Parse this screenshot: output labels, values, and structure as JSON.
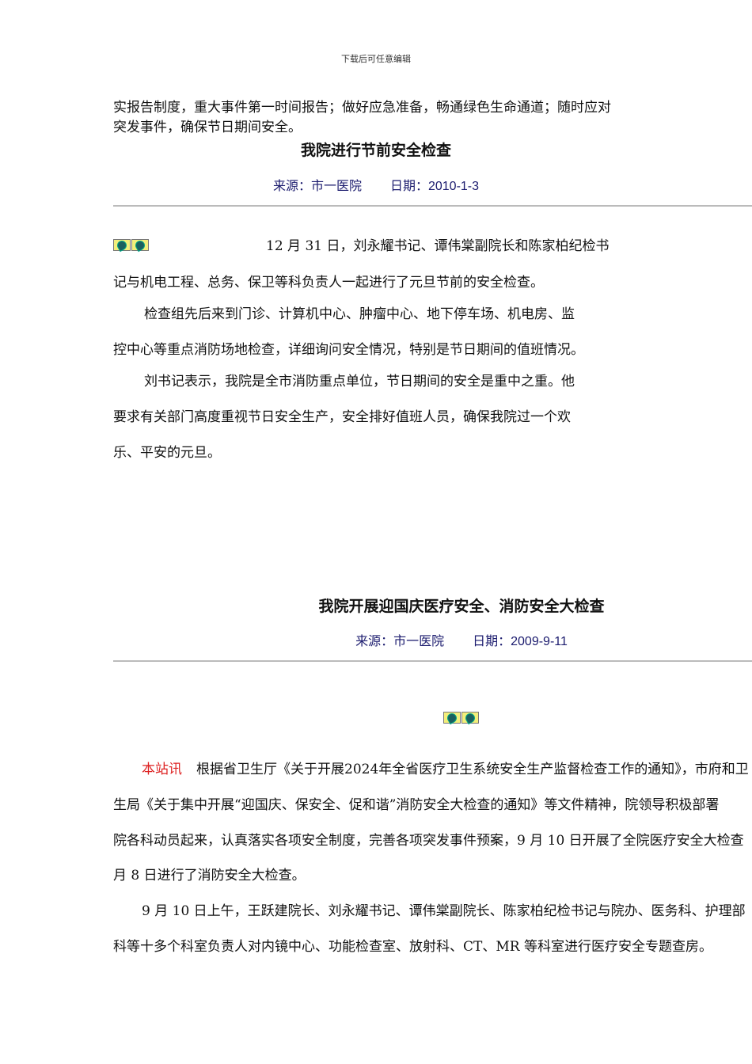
{
  "header": "下载后可任意编辑",
  "intro_lines": [
    "实报告制度，重大事件第一时间报告；做好应急准备，畅通绿色生命通道；随时应对",
    "突发事件，确保节日期间安全。"
  ],
  "article1": {
    "title": "我院进行节前安全检查",
    "source": "来源：市一医院",
    "date": "日期：2010-1-3",
    "lines": [
      "12 月 31 日，刘永耀书记、谭伟棠副院长和陈家柏纪检书",
      "记与机电工程、总务、保卫等科负责人一起进行了元旦节前的安全检查。",
      "检查组先后来到门诊、计算机中心、肿瘤中心、地下停车场、机电房、监",
      "控中心等重点消防场地检查，详细询问安全情况，特别是节日期间的值班情况。",
      "刘书记表示，我院是全市消防重点单位，节日期间的安全是重中之重。他",
      "要求有关部门高度重视节日安全生产，安全排好值班人员，确保我院过一个欢",
      "乐、平安的元旦。"
    ]
  },
  "article2": {
    "title": "我院开展迎国庆医疗安全、消防安全大检查",
    "source": "来源：市一医院",
    "date": "日期：2009-9-11",
    "lead": "本站讯",
    "lines": [
      "根据省卫生厅《关于开展2024年全省医疗卫生系统安全生产监督检查工作的通知》，市府和卫",
      "生局《关于集中开展“迎国庆、保安全、促和谐”消防安全大检查的通知》等文件精神，院领导积极部署",
      "院各科动员起来，认真落实各项安全制度，完善各项突发事件预案，9 月 10 日开展了全院医疗安全大检查",
      "月 8 日进行了消防安全大检查。",
      "9 月 10 日上午，王跃建院长、刘永耀书记、谭伟棠副院长、陈家柏纪检书记与院办、医务科、护理部",
      "科等十多个科室负责人对内镜中心、功能检查室、放射科、CT、MR 等科室进行医疗安全专题查房。"
    ]
  }
}
